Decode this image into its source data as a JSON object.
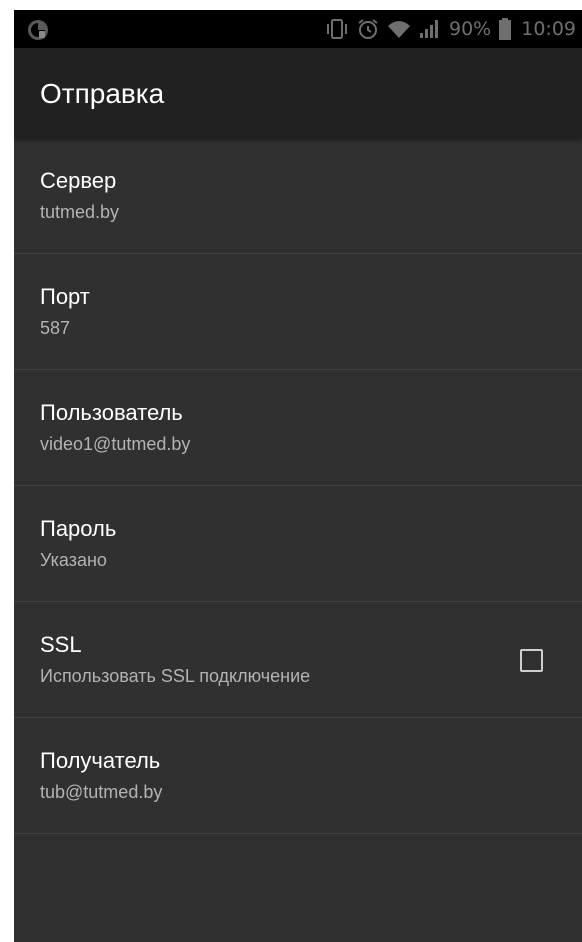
{
  "status_bar": {
    "battery_percent": "90%",
    "time": "10:09",
    "icons": [
      "app-notification-icon",
      "vibrate-icon",
      "alarm-icon",
      "wifi-icon",
      "signal-icon",
      "battery-icon"
    ]
  },
  "app_bar": {
    "title": "Отправка"
  },
  "settings": [
    {
      "title": "Сервер",
      "summary": "tutmed.by"
    },
    {
      "title": "Порт",
      "summary": "587"
    },
    {
      "title": "Пользователь",
      "summary": "video1@tutmed.by"
    },
    {
      "title": "Пароль",
      "summary": "Указано"
    },
    {
      "title": "SSL",
      "summary": "Использовать SSL подключение",
      "checked": false
    },
    {
      "title": "Получатель",
      "summary": "tub@tutmed.by"
    }
  ],
  "colors": {
    "background": "#303030",
    "app_bar": "#212121",
    "status_bar": "#000000",
    "title_text": "#ffffff",
    "summary_text": "#b3b3b3",
    "divider": "#3f3f3f"
  }
}
